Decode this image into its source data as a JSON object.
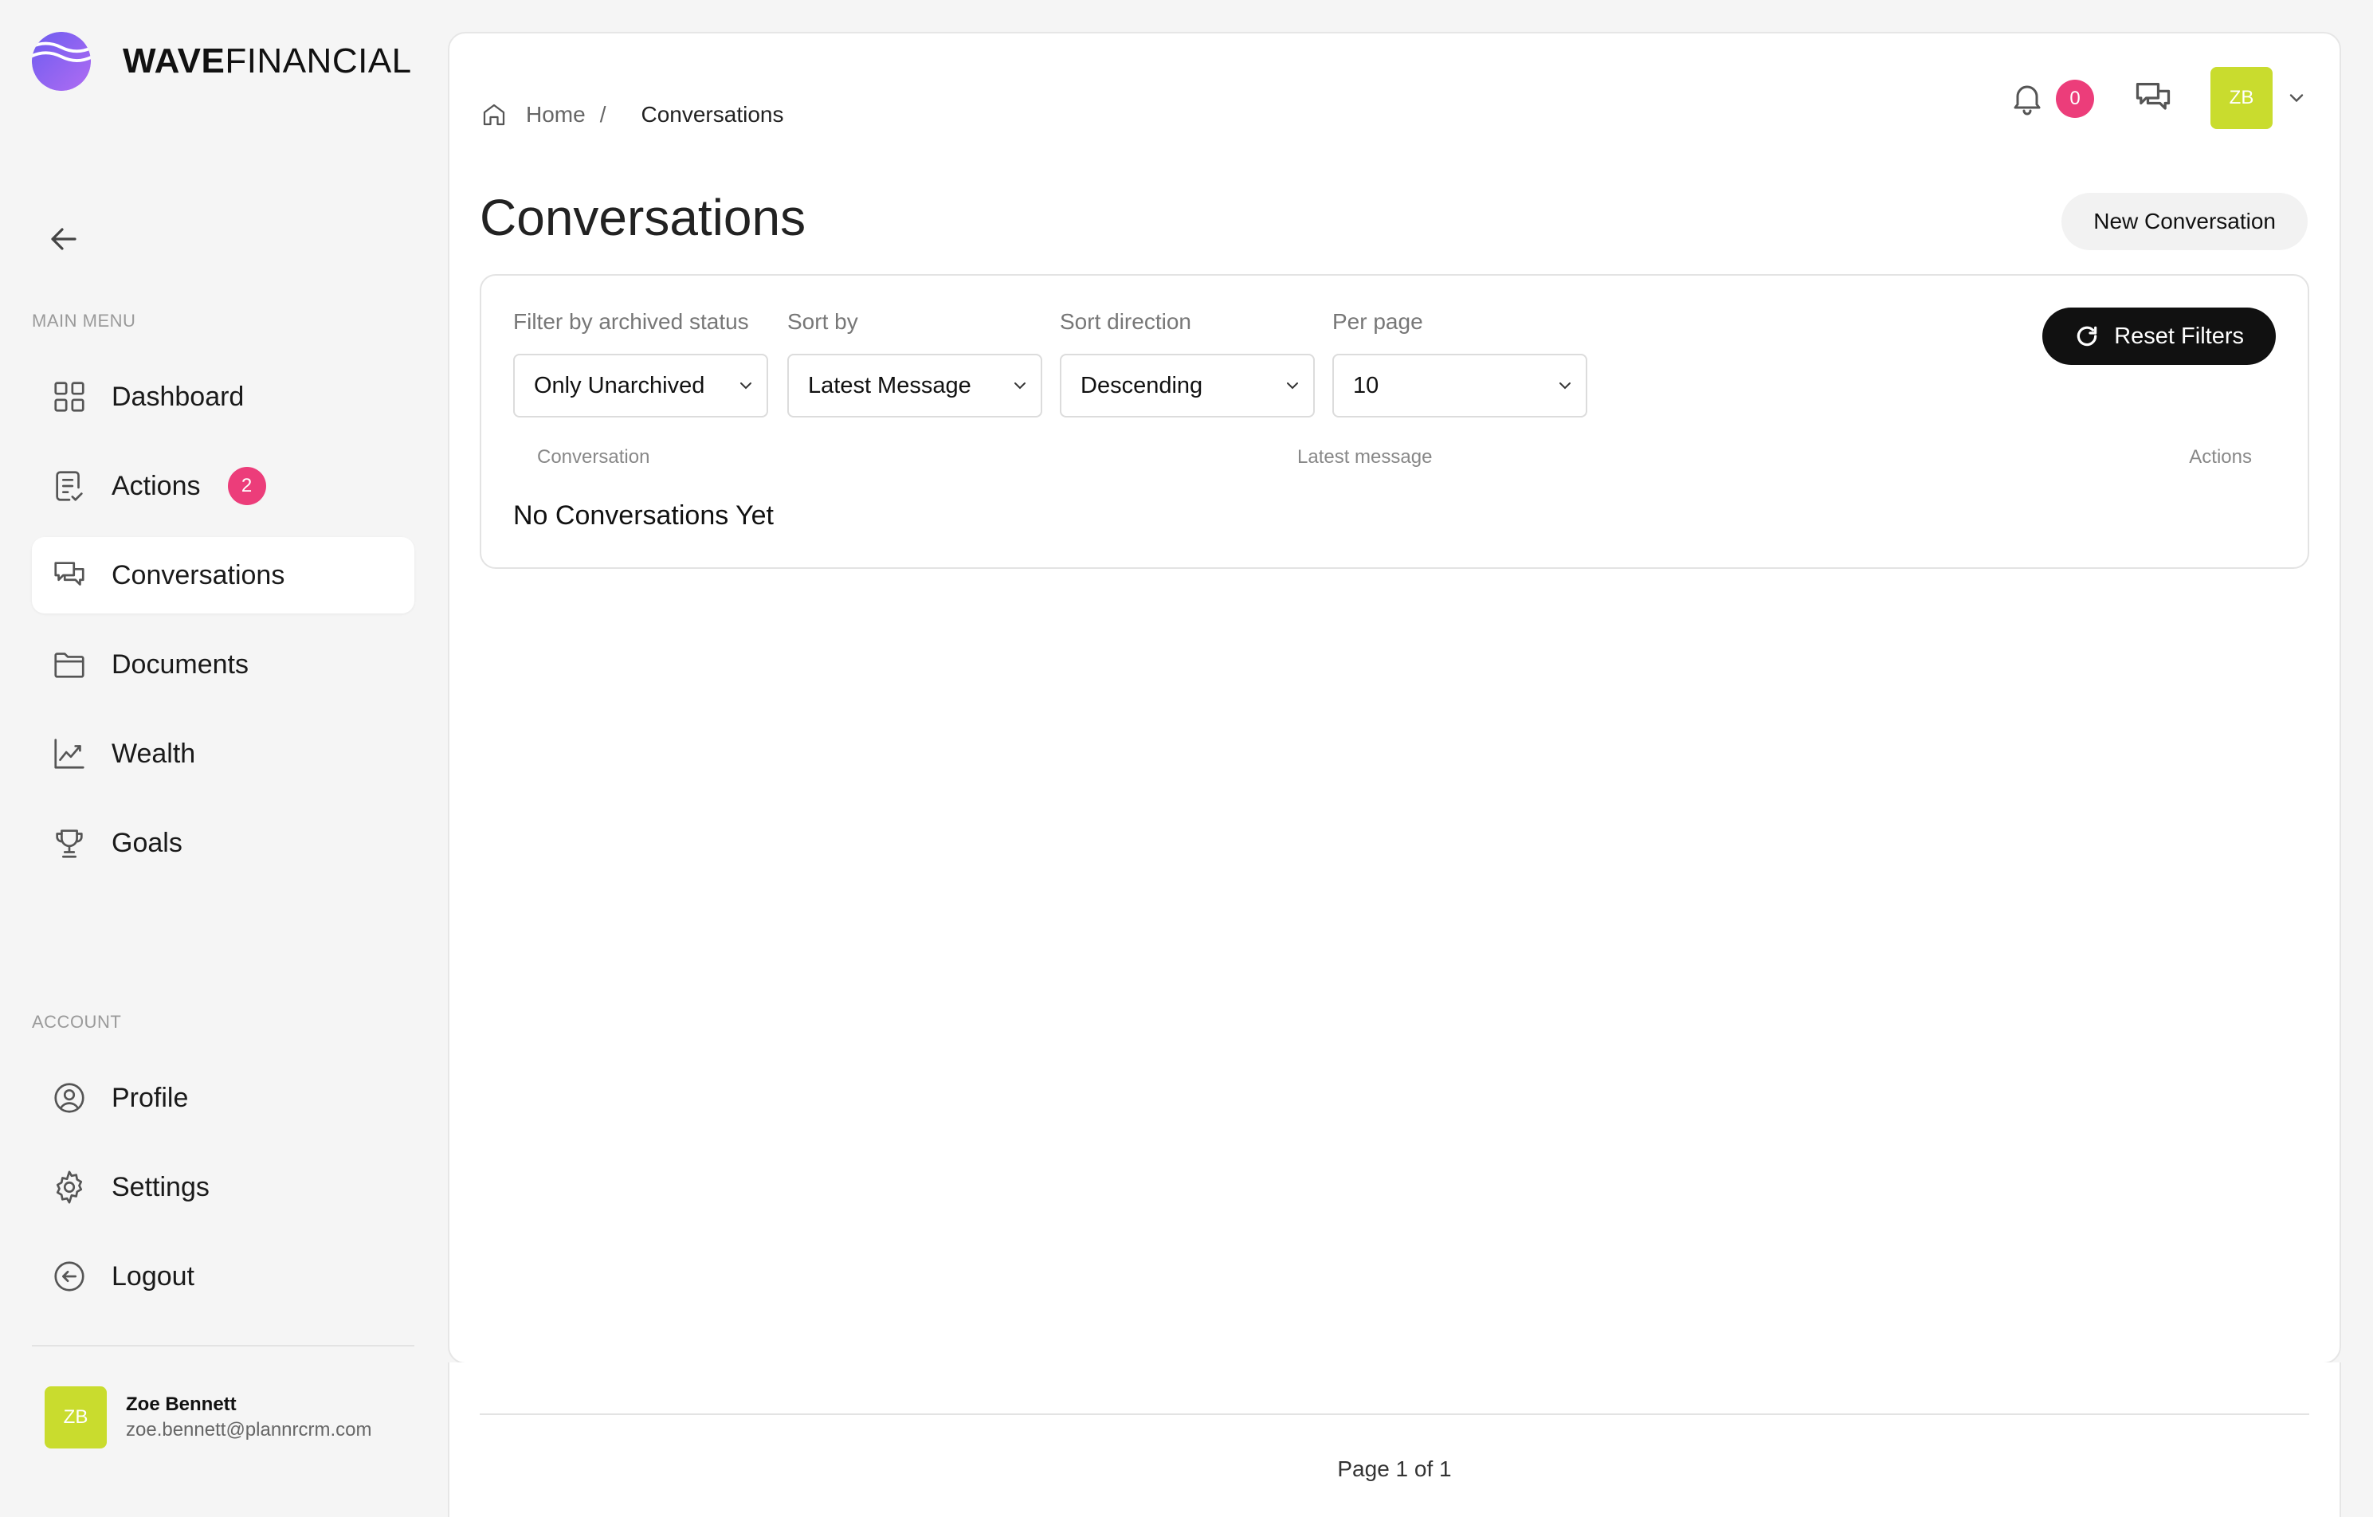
{
  "brand": {
    "name_bold": "WAVE",
    "name_rest": "FINANCIAL"
  },
  "sidebar": {
    "main_menu_label": "MAIN MENU",
    "account_label": "ACCOUNT",
    "items": [
      {
        "label": "Dashboard",
        "icon": "grid-icon"
      },
      {
        "label": "Actions",
        "icon": "clipboard-check-icon",
        "badge": "2"
      },
      {
        "label": "Conversations",
        "icon": "chat-bubbles-icon",
        "active": true
      },
      {
        "label": "Documents",
        "icon": "folder-icon"
      },
      {
        "label": "Wealth",
        "icon": "chart-line-icon"
      },
      {
        "label": "Goals",
        "icon": "trophy-icon"
      }
    ],
    "account_items": [
      {
        "label": "Profile",
        "icon": "user-circle-icon"
      },
      {
        "label": "Settings",
        "icon": "gear-icon"
      },
      {
        "label": "Logout",
        "icon": "logout-icon"
      }
    ],
    "user": {
      "initials": "ZB",
      "name": "Zoe Bennett",
      "email": "zoe.bennett@plannrcrm.com"
    }
  },
  "breadcrumb": {
    "home": "Home",
    "separator": "/",
    "current": "Conversations"
  },
  "topbar": {
    "notification_count": "0",
    "user_initials": "ZB"
  },
  "page": {
    "title": "Conversations",
    "new_button": "New Conversation"
  },
  "filters": {
    "archived": {
      "label": "Filter by archived status",
      "value": "Only Unarchived"
    },
    "sort_by": {
      "label": "Sort by",
      "value": "Latest Message"
    },
    "sort_direction": {
      "label": "Sort direction",
      "value": "Descending"
    },
    "per_page": {
      "label": "Per page",
      "value": "10"
    },
    "reset_label": "Reset Filters"
  },
  "table": {
    "columns": [
      "Conversation",
      "Latest message",
      "Actions"
    ],
    "empty_message": "No Conversations Yet"
  },
  "pagination": {
    "text": "Page 1 of 1"
  },
  "colors": {
    "accent_pink": "#ec3d7a",
    "avatar_lime": "#c9dc2e",
    "brand_purple": "#8b5cf6"
  }
}
